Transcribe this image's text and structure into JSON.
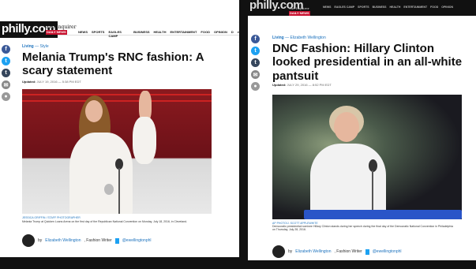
{
  "left_panel": {
    "site_logo": "philly.com",
    "paper_name_line1": "The Inquirer",
    "paper_badge": "DAILY NEWS",
    "nav": [
      "NEWS",
      "SPORTS",
      "EAGLES CAMP",
      "BUSINESS",
      "HEALTH",
      "ENTERTAINMENT",
      "FOOD",
      "OPINION",
      "D"
    ],
    "section": "Living",
    "subsection": "Style",
    "headline": "Melania Trump's RNC fashion: A scary statement",
    "updated_label": "Updated:",
    "updated_value": "JULY 19, 2016 — 5:38 PM EDT",
    "photo_credit": "JESSICA GRIFFIN / STAFF PHOTOGRAPHER",
    "caption": "Melania Trump at Quicken Loans Arena on the first day of the Republican National Convention on Monday, July 18, 2016, in Cleveland.",
    "byline_prefix": "by",
    "author": "Elizabeth Wellington",
    "author_role": ", Fashion Writer",
    "author_twitter": "@ewellingtonphl"
  },
  "right_panel": {
    "site_logo": "philly.com",
    "paper_name_line1": "The Inquirer",
    "paper_badge": "DAILY NEWS",
    "nav": [
      "NEWS",
      "EAGLES CAMP",
      "SPORTS",
      "BUSINESS",
      "HEALTH",
      "ENTERTAINMENT",
      "FOOD",
      "OPINION"
    ],
    "section": "Living",
    "subsection": "Elizabeth Wellington",
    "headline": "DNC Fashion: Hillary Clinton looked presidential in an all-white pantsuit",
    "updated_label": "Updated:",
    "updated_value": "JULY 29, 2016 — 8:52 PM EDT",
    "photo_credit": "AP PHOTO/J. SCOTT APPLEWHITE",
    "caption": "Democratic presidential nominee Hillary Clinton stands during her speech during the final day of the Democratic National Convention in Philadelphia on Thursday, July 28, 2016.",
    "byline_prefix": "by",
    "author": "Elizabeth Wellington",
    "author_role": ", Fashion Writer",
    "author_twitter": "@ewellingtonphl"
  },
  "social_icons": [
    "facebook-icon",
    "twitter-icon",
    "tumblr-icon",
    "email-icon",
    "comments-icon"
  ],
  "colors": {
    "accent": "#1e73be",
    "badge": "#c8102e",
    "facebook": "#3b5998",
    "twitter": "#1da1f2"
  }
}
